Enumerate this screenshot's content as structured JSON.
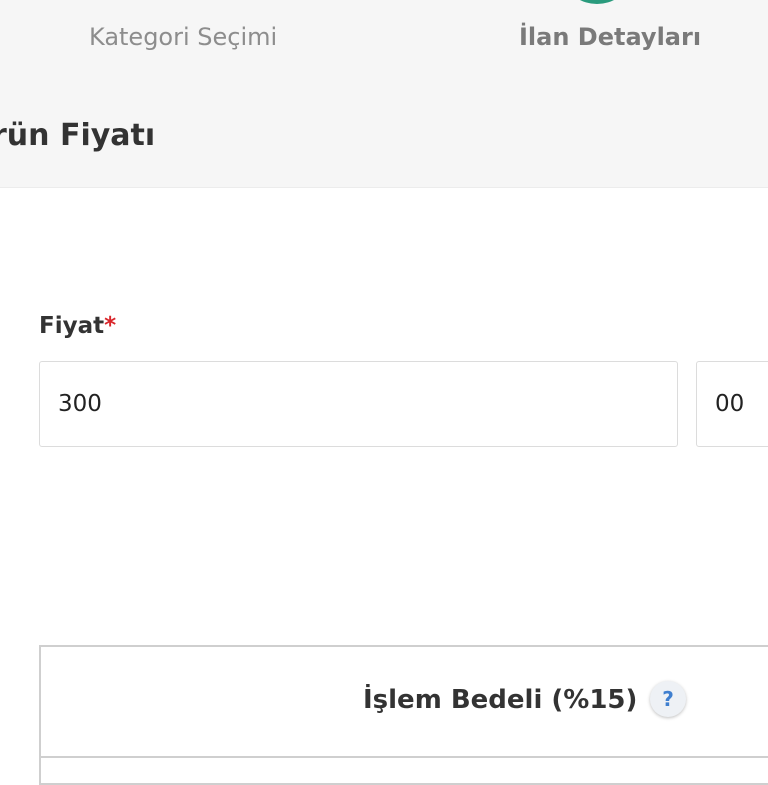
{
  "steps": {
    "category": "Kategori Seçimi",
    "details": "İlan Detayları"
  },
  "section": {
    "title": "rün Fiyatı"
  },
  "price": {
    "label": "Fiyat",
    "required_mark": "*",
    "value": "300",
    "decimal_value": "00"
  },
  "fee": {
    "title": "İşlem Bedeli (%15)",
    "help_glyph": "?"
  },
  "colors": {
    "accent": "#2a9b7d",
    "required": "#d9262b",
    "help": "#3f7fcf"
  }
}
